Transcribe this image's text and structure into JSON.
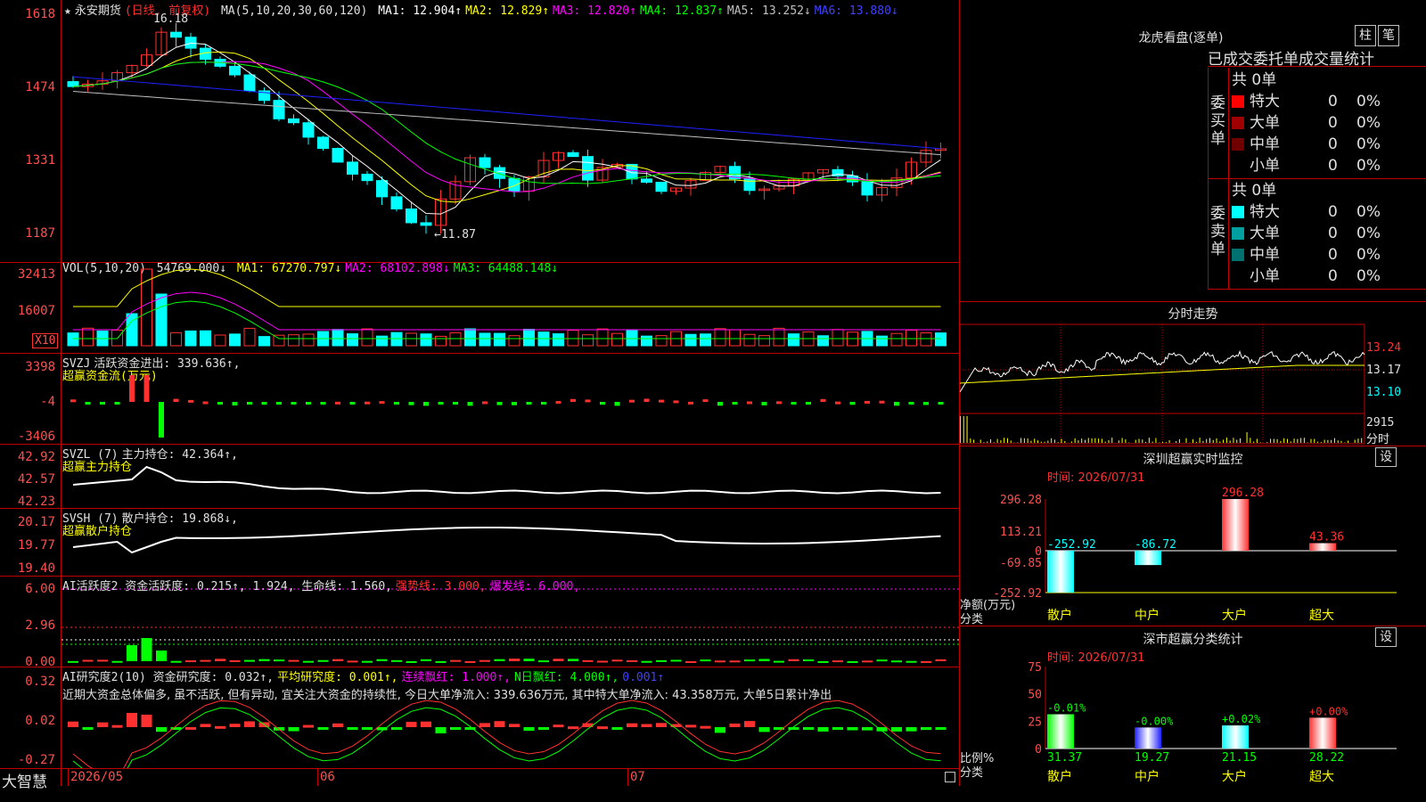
{
  "colors": {
    "up": "#ff3030",
    "down": "#00ffff",
    "grid": "#c00000",
    "ma1": "#ffffff",
    "ma2": "#ffff00",
    "ma3": "#ff00ff",
    "ma4": "#00ff00",
    "ma5": "#c0c0c0",
    "ma6": "#2020ff"
  },
  "main": {
    "title_star": "★",
    "stock": "永安期货",
    "period": "(日线, 前复权)",
    "ma_label": "MA(5,10,20,30,60,120)",
    "ma": [
      {
        "label": "MA1: 12.904↑",
        "color": "#ffffff"
      },
      {
        "label": "MA2: 12.829↑",
        "color": "#ffff00"
      },
      {
        "label": "MA3: 12.820↑",
        "color": "#ff00ff"
      },
      {
        "label": "MA4: 12.837↑",
        "color": "#00ff00"
      },
      {
        "label": "MA5: 13.252↓",
        "color": "#c0c0c0"
      },
      {
        "label": "MA6: 13.880↓",
        "color": "#4040ff"
      }
    ],
    "y_ticks": [
      "1618",
      "1474",
      "1331",
      "1187"
    ],
    "high_marker": "16.18",
    "low_marker": "←11.87"
  },
  "vol": {
    "label": "VOL(5,10,20)",
    "value": "54769.000↓",
    "ma": [
      {
        "label": "MA1: 67270.797↓",
        "color": "#ffff00"
      },
      {
        "label": "MA2: 68102.898↓",
        "color": "#ff00ff"
      },
      {
        "label": "MA3: 64488.148↓",
        "color": "#00ff00"
      }
    ],
    "y_ticks": [
      "32413",
      "16007"
    ],
    "unit": "X10"
  },
  "svzj": {
    "label": "SVZJ",
    "line1": "活跃资金进出: 339.636↑,",
    "line2": "超赢资金流(万元)",
    "y_ticks": [
      "3398",
      "-4",
      "-3406"
    ]
  },
  "svzl": {
    "label": "SVZL (7)",
    "line1": "主力持仓: 42.364↑,",
    "line2": "超赢主力持仓",
    "y_ticks": [
      "42.92",
      "42.57",
      "42.23"
    ]
  },
  "svsh": {
    "label": "SVSH (7)",
    "line1": "散户持仓: 19.868↓,",
    "line2": "超赢散户持仓",
    "y_ticks": [
      "20.17",
      "19.77",
      "19.40"
    ]
  },
  "ai1": {
    "label": "AI活跃度2 资金活跃度: 0.215↑, 1.924, 生命线: 1.560,",
    "strong": "强势线: 3.000,",
    "burst": "爆发线: 6.000,",
    "y_ticks": [
      "6.00",
      "2.96",
      "0.00"
    ]
  },
  "ai2": {
    "label": "AI研究度2(10) 资金研究度: 0.032↑,",
    "avg": "平均研究度: 0.001↑,",
    "cont": "连续飘红: 1.000↑,",
    "nday": "N日飘红: 4.000↑,",
    "last": "0.001↑",
    "comment": "近期大资金总体偏多, 虽不活跃, 但有异动, 宜关注大资金的持续性, 今日大单净流入: 339.636万元, 其中特大单净流入: 43.358万元, 大单5日累计净出",
    "y_ticks": [
      "0.32",
      "0.02",
      "-0.27"
    ]
  },
  "xaxis": {
    "labels": [
      "2026/05",
      "06",
      "07"
    ]
  },
  "app": {
    "brand": "大智慧"
  },
  "right": {
    "top_title": "龙虎看盘(逐单)",
    "btn_bar": "柱",
    "btn_pen": "笔",
    "tabs_text": "已成交委托单成交量统计",
    "buy_side": "委买单",
    "sell_side": "委卖单",
    "buy_total": "共 0单",
    "sell_total": "共 0单",
    "buy_rows": [
      {
        "name": "特大",
        "qty": "0",
        "pct": "0%",
        "color": "#ff0000"
      },
      {
        "name": "大单",
        "qty": "0",
        "pct": "0%",
        "color": "#a00000"
      },
      {
        "name": "中单",
        "qty": "0",
        "pct": "0%",
        "color": "#700000"
      },
      {
        "name": "小单",
        "qty": "0",
        "pct": "0%",
        "color": "#000000"
      }
    ],
    "sell_rows": [
      {
        "name": "特大",
        "qty": "0",
        "pct": "0%",
        "color": "#00ffff"
      },
      {
        "name": "大单",
        "qty": "0",
        "pct": "0%",
        "color": "#00a0a0"
      },
      {
        "name": "中单",
        "qty": "0",
        "pct": "0%",
        "color": "#007070"
      },
      {
        "name": "小单",
        "qty": "0",
        "pct": "0%",
        "color": "#000000"
      }
    ],
    "intraday_title": "分时走势",
    "intraday_prices": [
      "13.24",
      "13.17",
      "13.10"
    ],
    "intraday_vol": "2915",
    "intraday_unit": "分时",
    "monitor_title": "深圳超赢实时监控",
    "monitor_btn": "设",
    "monitor_time": "时间: 2026/07/31",
    "monitor_ticks": [
      "296.28",
      "113.21",
      "0",
      "-69.85",
      "-252.92"
    ],
    "monitor_unit": "净额(万元)",
    "monitor_cat": "分类",
    "stats_title": "深市超赢分类统计",
    "stats_btn": "设",
    "stats_time": "时间: 2026/07/31",
    "stats_ticks": [
      "75",
      "50",
      "25",
      "0"
    ],
    "stats_unit": "比例%",
    "stats_cat": "分类"
  },
  "chart_data": [
    {
      "type": "bar",
      "title": "深圳超赢实时监控",
      "ylabel": "净额(万元)",
      "xlabel": "分类",
      "categories": [
        "散户",
        "中户",
        "大户",
        "超大"
      ],
      "values": [
        -252.92,
        -86.72,
        296.28,
        43.36
      ],
      "ylim": [
        -252.92,
        296.28
      ]
    },
    {
      "type": "bar",
      "title": "深市超赢分类统计",
      "ylabel": "比例%",
      "xlabel": "分类",
      "categories": [
        "散户",
        "中户",
        "大户",
        "超大"
      ],
      "values": [
        31.37,
        19.27,
        21.15,
        28.22
      ],
      "changes": [
        "-0.01%",
        "-0.00%",
        "+0.02%",
        "+0.00%"
      ],
      "colors": [
        "#00ff00",
        "#2020ff",
        "#00ffff",
        "#ff3030"
      ],
      "ylim": [
        0,
        75
      ]
    }
  ]
}
